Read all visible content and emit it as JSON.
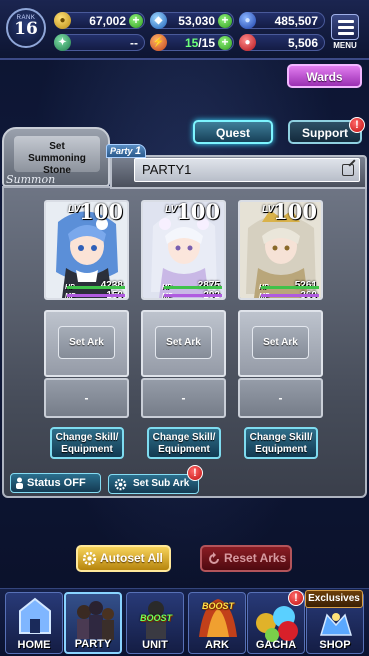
{
  "header": {
    "rank_label": "RANK",
    "rank_value": "16",
    "gold": "67,002",
    "crystals": "53,030",
    "orbs": "485,507",
    "unknown_value": "--",
    "stamina": "15/15",
    "stamina_current": "15",
    "stamina_max": "15",
    "red_gems": "5,506",
    "menu_label": "MENU"
  },
  "buttons": {
    "wards": "Wards",
    "quest": "Quest",
    "support": "Support",
    "badge": "!"
  },
  "summon": {
    "set_line1": "Set",
    "set_line2": "Summoning Stone",
    "tag": "Summon"
  },
  "party": {
    "tab_label": "Party",
    "tab_number": "1",
    "name": "PARTY1"
  },
  "characters": [
    {
      "lv_label": "LV",
      "level": "100",
      "hp_label": "HP",
      "hp": "4238",
      "mp_label": "MP",
      "mp": "150"
    },
    {
      "lv_label": "LV",
      "level": "100",
      "hp_label": "HP",
      "hp": "2875",
      "mp_label": "MP",
      "mp": "292"
    },
    {
      "lv_label": "LV",
      "level": "100",
      "hp_label": "HP",
      "hp": "5261",
      "mp_label": "MP",
      "mp": "360"
    }
  ],
  "slots": {
    "set_ark": "Set Ark",
    "sub_empty": "-",
    "change_line1": "Change Skill/",
    "change_line2": "Equipment"
  },
  "toggles": {
    "status": "Status OFF",
    "set_sub_ark": "Set Sub Ark"
  },
  "actions": {
    "autoset": "Autoset All",
    "reset": "Reset Arks"
  },
  "nav": {
    "home": "HOME",
    "party": "PARTY",
    "unit": "UNIT",
    "ark": "ARK",
    "gacha": "GACHA",
    "shop": "SHOP",
    "boost": "BOOST",
    "exclusives": "Exclusives"
  },
  "colors": {
    "accent_cyan": "#7df4ff",
    "wards_purple": "#c04ad8",
    "autoset_gold": "#e0b02a",
    "reset_red": "#8a1d24",
    "badge_red": "#d8181c"
  },
  "icons": [
    "gold-coin-icon",
    "crystal-icon",
    "orb-icon",
    "compass-icon",
    "stamina-icon",
    "gem-icon",
    "menu-icon",
    "edit-icon",
    "person-icon",
    "gear-icon",
    "home-icon",
    "gacha-icon",
    "shop-icon"
  ]
}
